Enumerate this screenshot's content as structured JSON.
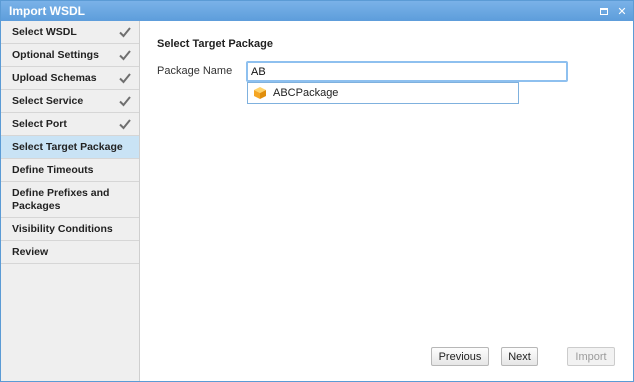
{
  "window": {
    "title": "Import WSDL"
  },
  "steps": [
    {
      "label": "Select WSDL",
      "done": true
    },
    {
      "label": "Optional Settings",
      "done": true
    },
    {
      "label": "Upload Schemas",
      "done": true
    },
    {
      "label": "Select Service",
      "done": true
    },
    {
      "label": "Select Port",
      "done": true
    },
    {
      "label": "Select Target Package",
      "active": true
    },
    {
      "label": "Define Timeouts"
    },
    {
      "label": "Define Prefixes and Packages"
    },
    {
      "label": "Visibility Conditions"
    },
    {
      "label": "Review"
    }
  ],
  "main": {
    "heading": "Select Target Package",
    "package_name_label": "Package Name",
    "package_name_value": "AB",
    "suggestion": "ABCPackage"
  },
  "buttons": {
    "previous": "Previous",
    "next": "Next",
    "import": "Import"
  },
  "colors": {
    "titlebar": "#5d9ddb",
    "active_step": "#c9e3f5",
    "input_focus": "#8ec0ef",
    "package_icon": "#f5a623"
  },
  "icons": {
    "done": "check-icon",
    "package": "package-icon",
    "window_restore": "restore-icon",
    "window_close": "close-icon"
  }
}
